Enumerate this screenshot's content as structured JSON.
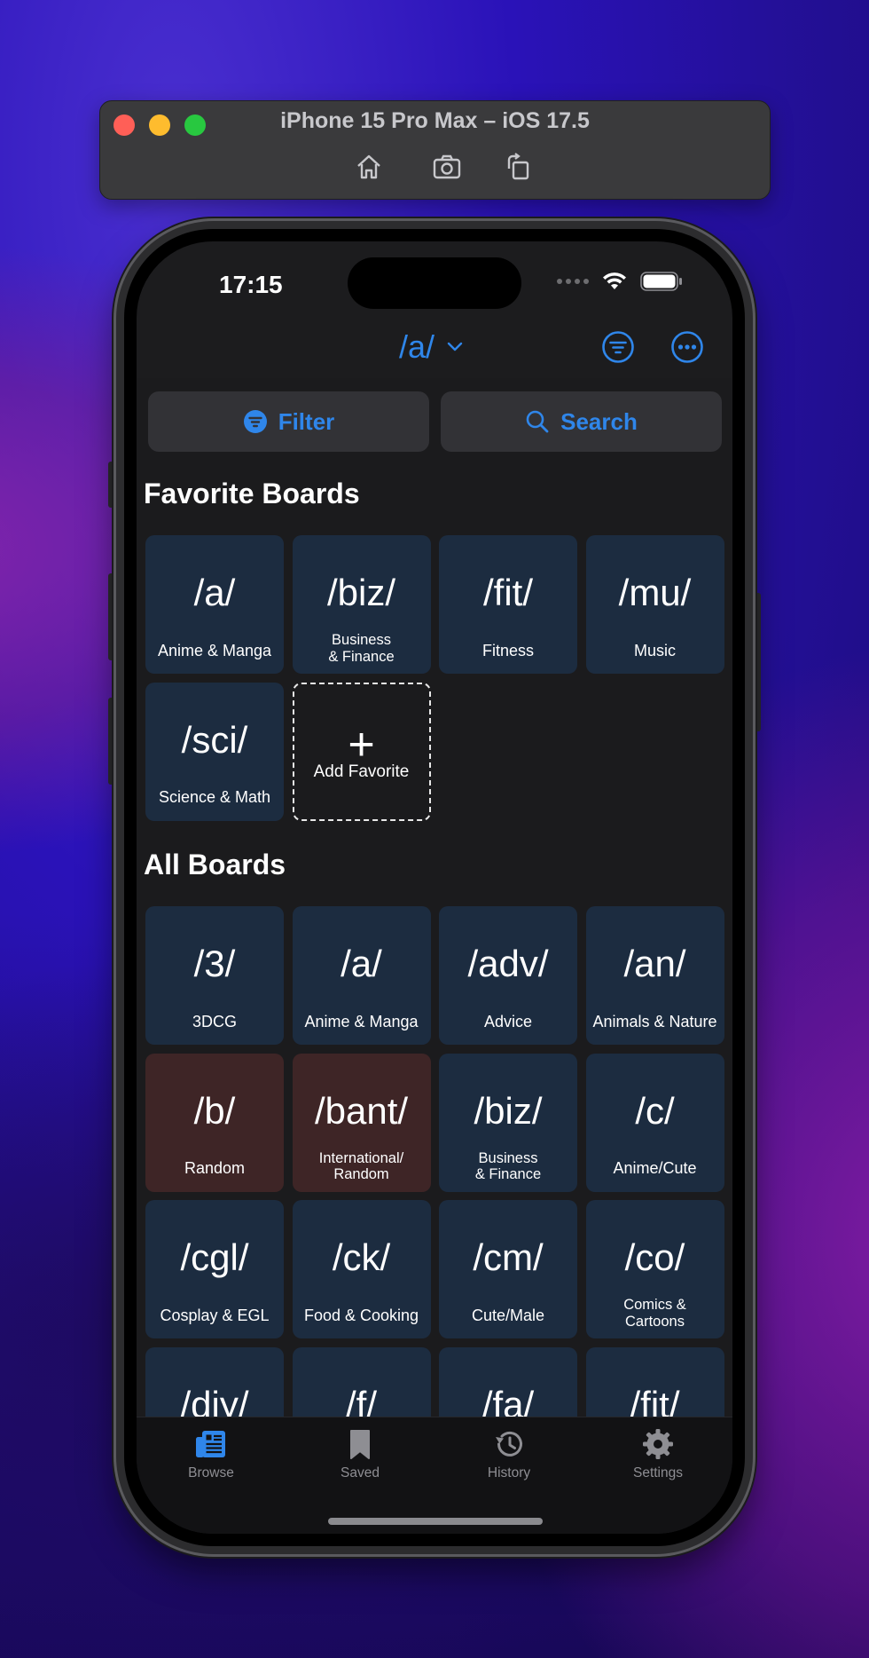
{
  "simulator": {
    "title": "iPhone 15 Pro Max – iOS 17.5",
    "tools": [
      {
        "name": "home-icon"
      },
      {
        "name": "screenshot-icon"
      },
      {
        "name": "rotate-icon"
      }
    ]
  },
  "status_bar": {
    "time": "17:15"
  },
  "nav": {
    "board": "/a/",
    "icons": [
      "filter-circle-icon",
      "more-circle-icon"
    ]
  },
  "toolbar": {
    "filter_label": "Filter",
    "search_label": "Search"
  },
  "favorites": {
    "title": "Favorite Boards",
    "boards": [
      {
        "code": "/a/",
        "desc": "Anime & Manga",
        "nsfw": false
      },
      {
        "code": "/biz/",
        "desc": "Business\n& Finance",
        "nsfw": false
      },
      {
        "code": "/fit/",
        "desc": "Fitness",
        "nsfw": false
      },
      {
        "code": "/mu/",
        "desc": "Music",
        "nsfw": false
      },
      {
        "code": "/sci/",
        "desc": "Science & Math",
        "nsfw": false
      }
    ],
    "add_label": "Add Favorite"
  },
  "all_boards": {
    "title": "All Boards",
    "boards": [
      {
        "code": "/3/",
        "desc": "3DCG",
        "nsfw": false
      },
      {
        "code": "/a/",
        "desc": "Anime & Manga",
        "nsfw": false
      },
      {
        "code": "/adv/",
        "desc": "Advice",
        "nsfw": false
      },
      {
        "code": "/an/",
        "desc": "Animals & Nature",
        "nsfw": false
      },
      {
        "code": "/b/",
        "desc": "Random",
        "nsfw": true
      },
      {
        "code": "/bant/",
        "desc": "International/\nRandom",
        "nsfw": true
      },
      {
        "code": "/biz/",
        "desc": "Business\n& Finance",
        "nsfw": false
      },
      {
        "code": "/c/",
        "desc": "Anime/Cute",
        "nsfw": false
      },
      {
        "code": "/cgl/",
        "desc": "Cosplay & EGL",
        "nsfw": false
      },
      {
        "code": "/ck/",
        "desc": "Food & Cooking",
        "nsfw": false
      },
      {
        "code": "/cm/",
        "desc": "Cute/Male",
        "nsfw": false
      },
      {
        "code": "/co/",
        "desc": "Comics &\nCartoons",
        "nsfw": false
      },
      {
        "code": "/diy/",
        "desc": "",
        "nsfw": false
      },
      {
        "code": "/f/",
        "desc": "",
        "nsfw": false
      },
      {
        "code": "/fa/",
        "desc": "",
        "nsfw": false
      },
      {
        "code": "/fit/",
        "desc": "",
        "nsfw": false
      }
    ]
  },
  "tabs": [
    {
      "label": "Browse",
      "icon": "browse-icon",
      "active": true
    },
    {
      "label": "Saved",
      "icon": "bookmark-icon",
      "active": false
    },
    {
      "label": "History",
      "icon": "history-icon",
      "active": false
    },
    {
      "label": "Settings",
      "icon": "gear-icon",
      "active": false
    }
  ],
  "colors": {
    "accent": "#2f86ea",
    "tile_sfw": "#1c2c40",
    "tile_nsfw": "#3e2526",
    "background": "#1c1c1e"
  }
}
